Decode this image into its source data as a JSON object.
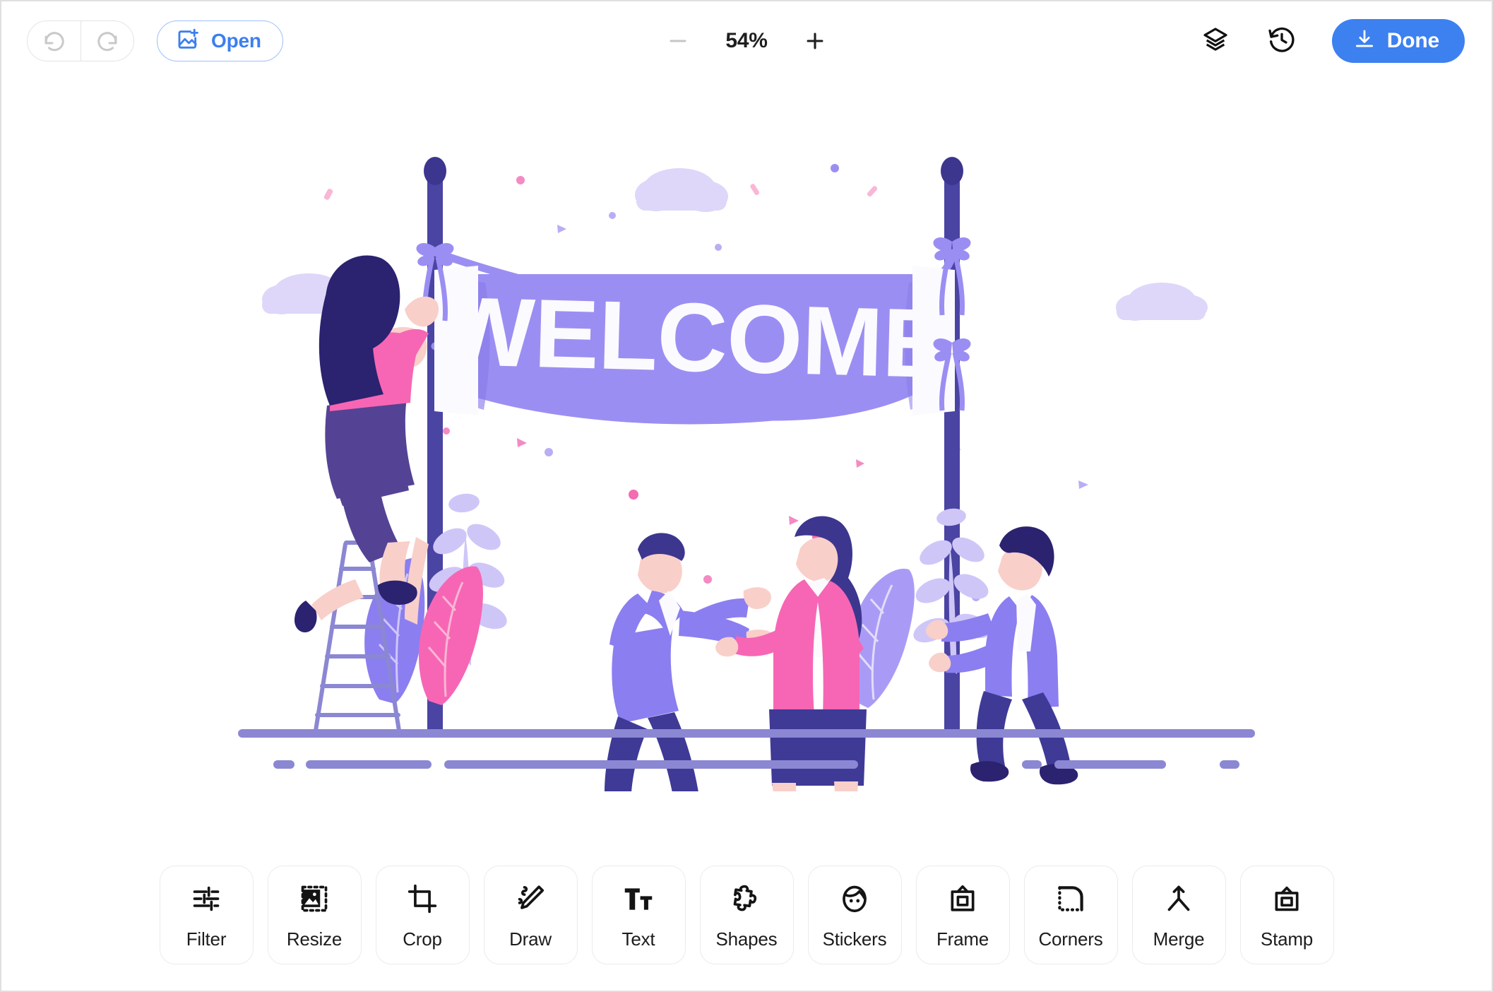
{
  "header": {
    "undo_label": "Undo",
    "redo_label": "Redo",
    "open_label": "Open",
    "zoom": {
      "decrease_label": "Zoom out",
      "level": "54%",
      "increase_label": "Zoom in"
    },
    "layers_label": "Layers",
    "history_label": "History",
    "done_label": "Done"
  },
  "toolbar": {
    "tools": [
      {
        "label": "Filter",
        "icon": "sliders-icon"
      },
      {
        "label": "Resize",
        "icon": "resize-image-icon"
      },
      {
        "label": "Crop",
        "icon": "crop-icon"
      },
      {
        "label": "Draw",
        "icon": "pencil-icon"
      },
      {
        "label": "Text",
        "icon": "text-size-icon"
      },
      {
        "label": "Shapes",
        "icon": "puzzle-piece-icon"
      },
      {
        "label": "Stickers",
        "icon": "sticker-face-icon"
      },
      {
        "label": "Frame",
        "icon": "frame-icon"
      },
      {
        "label": "Corners",
        "icon": "rounded-corner-icon"
      },
      {
        "label": "Merge",
        "icon": "merge-arrow-icon"
      },
      {
        "label": "Stamp",
        "icon": "stamp-icon"
      }
    ]
  },
  "canvas": {
    "artwork_title": "WELCOME",
    "banner_text": "WELCOME",
    "description": "Illustration of people hanging a welcome banner between two poles"
  },
  "colors": {
    "accent_blue": "#3d80f0",
    "open_blue": "#3b7ff0",
    "banner_purple": "#9b8ef2",
    "pole_navy": "#3f3a96",
    "pink": "#f766b4",
    "light_lavender": "#ddd6f8",
    "periwinkle": "#7d7ae8",
    "dark_navy": "#2b2270",
    "skin": "#f9cfca",
    "ground": "#8b87d3",
    "border_grey": "#ebebeb"
  }
}
